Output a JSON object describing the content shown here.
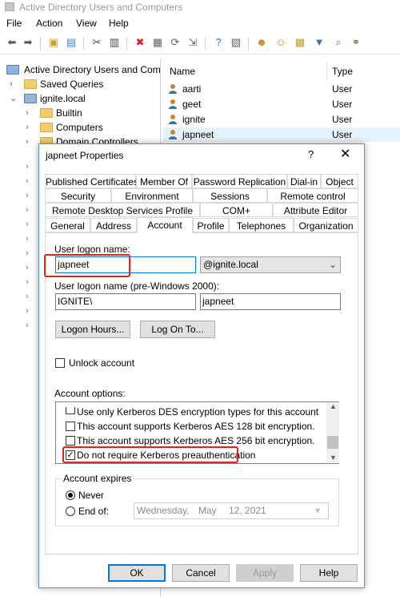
{
  "window": {
    "title": "Active Directory Users and Computers"
  },
  "menu": [
    "File",
    "Action",
    "View",
    "Help"
  ],
  "toolbar_icons": [
    "back-arrow-icon",
    "forward-arrow-icon",
    "folder-up-icon",
    "details-view-icon",
    "cut-icon",
    "clipboard-icon",
    "delete-icon",
    "properties-icon",
    "refresh-icon",
    "export-icon",
    "help-icon",
    "console-tree-icon",
    "new-user-icon",
    "new-group-icon",
    "new-ou-icon",
    "filter-icon",
    "find-icon",
    "add-to-group-icon"
  ],
  "tree": {
    "root": "Active Directory Users and Com",
    "items": [
      {
        "label": "Saved Queries"
      },
      {
        "label": "ignite.local"
      },
      {
        "label": "Builtin"
      },
      {
        "label": "Computers"
      },
      {
        "label": "Domain Controllers"
      }
    ]
  },
  "list": {
    "columns": [
      "Name",
      "Type"
    ],
    "rows": [
      {
        "name": "aarti",
        "type": "User"
      },
      {
        "name": "geet",
        "type": "User"
      },
      {
        "name": "ignite",
        "type": "User"
      },
      {
        "name": "japneet",
        "type": "User"
      }
    ]
  },
  "dialog": {
    "title": "japneet Properties",
    "help": "?",
    "close": "✕",
    "tabs_row1": [
      "Published Certificates",
      "Member Of",
      "Password Replication",
      "Dial-in",
      "Object"
    ],
    "tabs_row2": [
      "Security",
      "Environment",
      "Sessions",
      "Remote control"
    ],
    "tabs_row3": [
      "Remote Desktop Services Profile",
      "COM+",
      "Attribute Editor"
    ],
    "tabs_row4": [
      "General",
      "Address",
      "Account",
      "Profile",
      "Telephones",
      "Organization"
    ],
    "logon_name_label": "User logon name:",
    "logon_name_value": "japneet",
    "domain_suffix": "@ignite.local",
    "pre2000_label": "User logon name (pre-Windows 2000):",
    "pre2000_domain": "IGNITE\\",
    "pre2000_name": "japneet",
    "logon_hours_button": "Logon Hours...",
    "log_on_to_button": "Log On To...",
    "unlock_label": "Unlock account",
    "account_options_label": "Account options:",
    "options": [
      {
        "label": "Use only Kerberos DES encryption types for this account",
        "checked": false
      },
      {
        "label": "This account supports Kerberos AES 128 bit encryption.",
        "checked": false
      },
      {
        "label": "This account supports Kerberos AES 256 bit encryption.",
        "checked": false
      },
      {
        "label": "Do not require Kerberos preauthentication",
        "checked": true
      }
    ],
    "account_expires_label": "Account expires",
    "never_label": "Never",
    "end_of_label": "End of:",
    "date_parts": [
      "Wednesday,",
      "May",
      "12, 2021"
    ],
    "buttons": {
      "ok": "OK",
      "cancel": "Cancel",
      "apply": "Apply",
      "help": "Help"
    }
  },
  "colors": {
    "highlight": "#e0221c",
    "selected_row": "#e5f1fb",
    "accent": "#0078d7"
  }
}
